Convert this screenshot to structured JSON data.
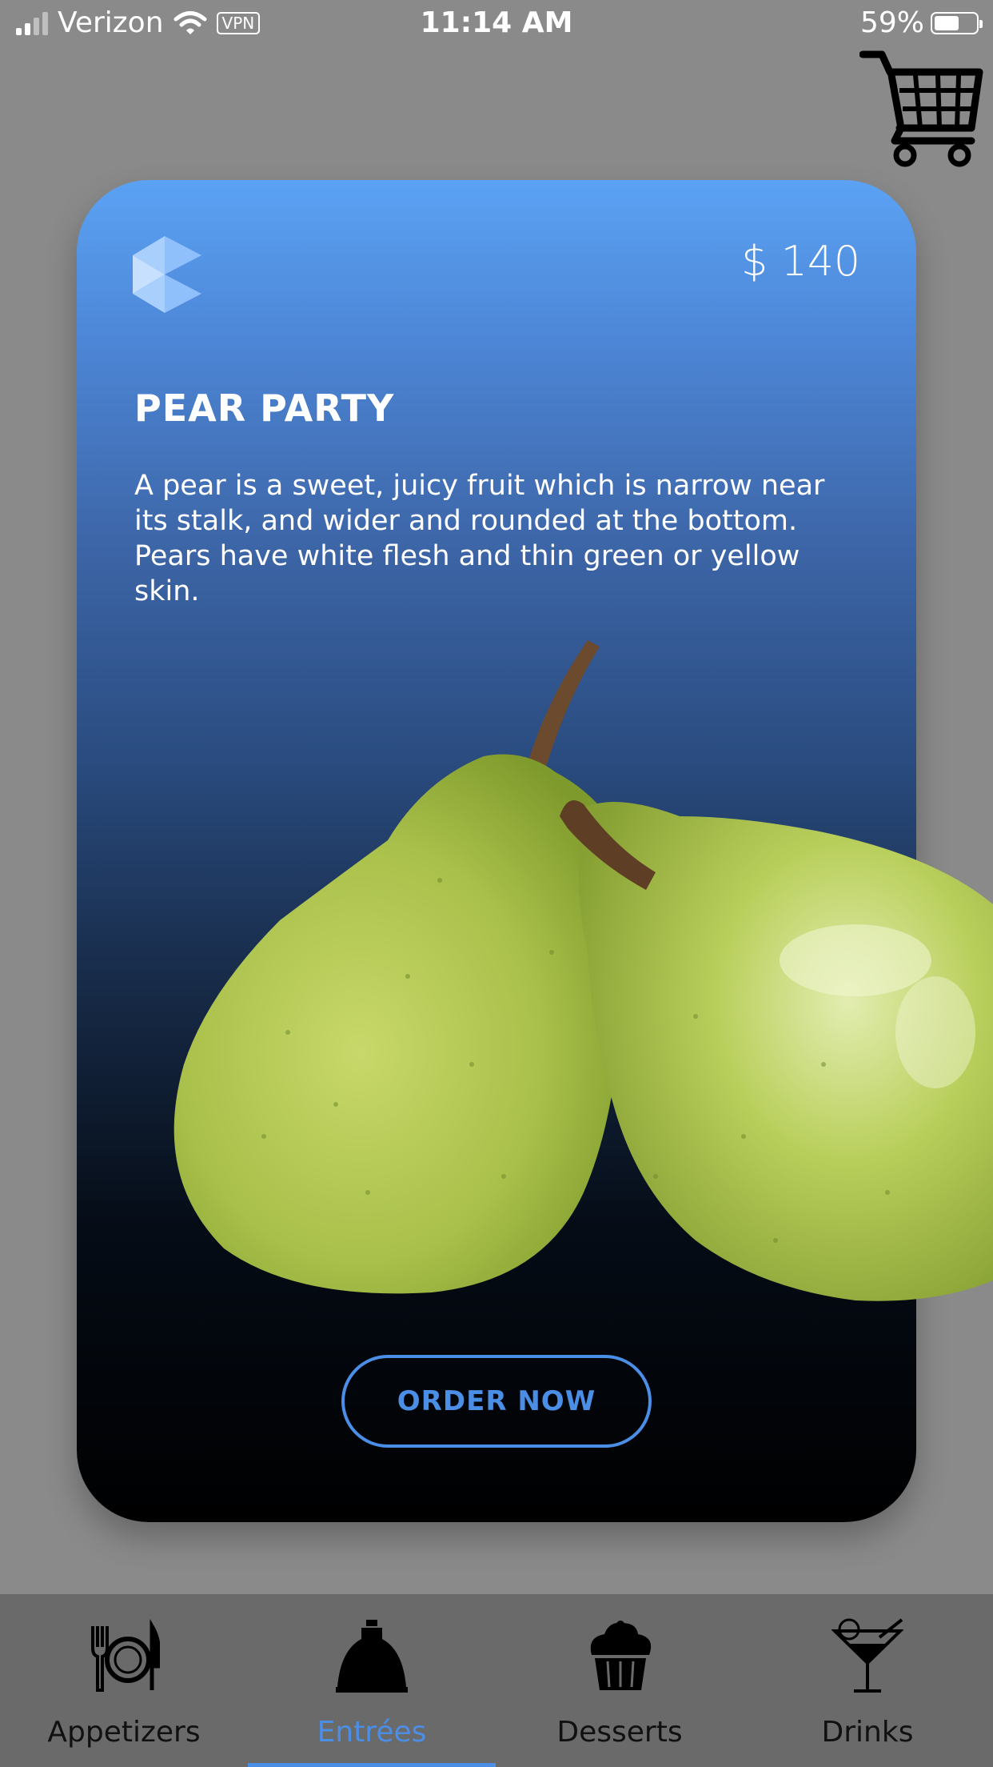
{
  "status_bar": {
    "carrier": "Verizon",
    "vpn": "VPN",
    "time": "11:14 AM",
    "battery": "59%",
    "battery_level": 0.59
  },
  "cart": {
    "icon": "cart-icon"
  },
  "card": {
    "logo_icon": "brand-cube-icon",
    "price": "$ 140",
    "title": "PEAR PARTY",
    "description": "A pear is a sweet, juicy fruit which is narrow near its stalk, and wider and rounded at the bottom. Pears have white flesh and thin green or yellow skin.",
    "order_label": "ORDER NOW",
    "gradient_top": "#5ba2f4",
    "accent": "#4a8ee6"
  },
  "tabs": [
    {
      "label": "Appetizers",
      "icon": "plate-cutlery-icon",
      "active": false
    },
    {
      "label": "Entrées",
      "icon": "cloche-icon",
      "active": true
    },
    {
      "label": "Desserts",
      "icon": "cupcake-icon",
      "active": false
    },
    {
      "label": "Drinks",
      "icon": "cocktail-icon",
      "active": false
    }
  ]
}
